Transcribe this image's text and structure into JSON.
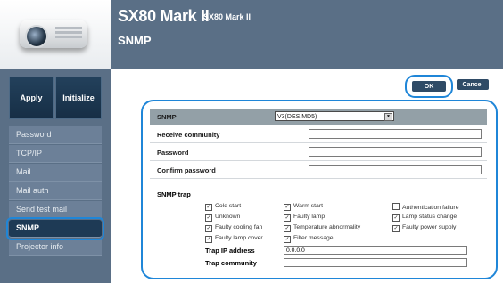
{
  "header": {
    "model": "SX80 Mark II",
    "model_small": "SX80 Mark II",
    "page_title": "SNMP"
  },
  "sidebar": {
    "apply_label": "Apply",
    "initialize_label": "Initialize",
    "items": [
      {
        "label": "Password"
      },
      {
        "label": "TCP/IP"
      },
      {
        "label": "Mail"
      },
      {
        "label": "Mail auth"
      },
      {
        "label": "Send test mail"
      },
      {
        "label": "SNMP",
        "active": true
      },
      {
        "label": "Projector info"
      }
    ]
  },
  "actions": {
    "ok_label": "OK",
    "cancel_label": "Cancel"
  },
  "form": {
    "snmp_label": "SNMP",
    "snmp_value": "V3(DES,MD5)",
    "receive_community_label": "Receive community",
    "receive_community_value": "",
    "password_label": "Password",
    "password_value": "",
    "confirm_password_label": "Confirm password",
    "confirm_password_value": "",
    "snmp_trap_label": "SNMP trap",
    "traps": [
      {
        "label": "Cold start",
        "checked": true
      },
      {
        "label": "Warm start",
        "checked": true
      },
      {
        "label": "Authentication failure",
        "checked": false
      },
      {
        "label": "Unknown",
        "checked": true
      },
      {
        "label": "Faulty lamp",
        "checked": true
      },
      {
        "label": "Lamp status change",
        "checked": true
      },
      {
        "label": "Faulty cooling fan",
        "checked": true
      },
      {
        "label": "Temperature abnormality",
        "checked": true
      },
      {
        "label": "Faulty power supply",
        "checked": true
      },
      {
        "label": "Faulty lamp cover",
        "checked": true
      },
      {
        "label": "Filter message",
        "checked": true
      }
    ],
    "trap_ip_label": "Trap IP address",
    "trap_ip_value": "0.0.0.0",
    "trap_community_label": "Trap community",
    "trap_community_value": ""
  }
}
